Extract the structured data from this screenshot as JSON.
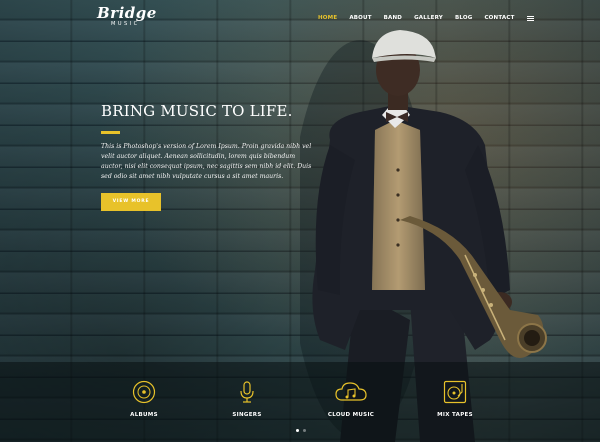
{
  "brand": {
    "name": "Bridge",
    "sub": "MUSIC"
  },
  "nav": {
    "items": [
      {
        "label": "HOME",
        "active": true
      },
      {
        "label": "ABOUT"
      },
      {
        "label": "BAND"
      },
      {
        "label": "GALLERY"
      },
      {
        "label": "BLOG"
      },
      {
        "label": "CONTACT"
      }
    ],
    "menu_icon": "hamburger-icon"
  },
  "hero": {
    "title": "BRING MUSIC TO LIFE.",
    "body": "This is Photoshop's version of Lorem Ipsum. Proin gravida nibh vel velit auctor aliquet. Aenean sollicitudin, lorem quis bibendum auctor, nisi elit consequat ipsum, nec sagittis sem nibh id elit. Duis sed odio sit amet nibh vulputate cursus a sit amet mauris.",
    "cta_label": "VIEW MORE"
  },
  "features": [
    {
      "label": "ALBUMS",
      "icon": "vinyl-icon"
    },
    {
      "label": "SINGERS",
      "icon": "microphone-icon"
    },
    {
      "label": "CLOUD MUSIC",
      "icon": "cloud-music-icon"
    },
    {
      "label": "MIX TAPES",
      "icon": "turntable-icon"
    }
  ],
  "slider": {
    "slides": 2,
    "active": 1
  },
  "colors": {
    "accent": "#e8c22a",
    "text": "#ffffff"
  }
}
